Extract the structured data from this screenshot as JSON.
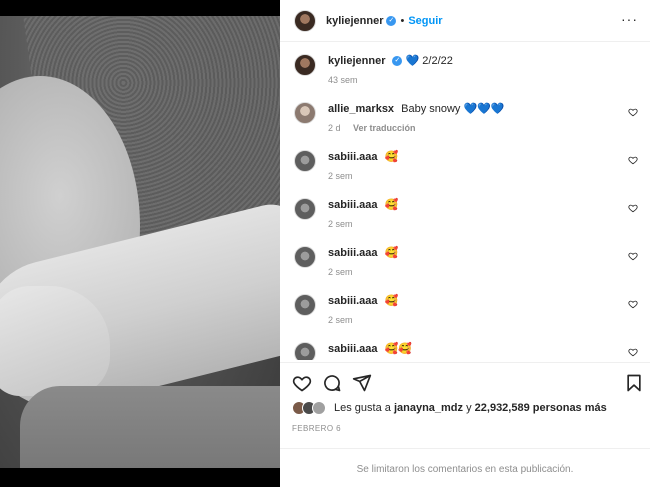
{
  "post": {
    "username": "kyliejenner",
    "follow_label": "Seguir",
    "more_label": "···"
  },
  "caption": {
    "username": "kyliejenner",
    "text": "💙 2/2/22",
    "age": "43 sem"
  },
  "comments": [
    {
      "username": "allie_marksx",
      "text": "Baby snowy 💙💙💙",
      "age": "2 d",
      "translate": "Ver traducción"
    },
    {
      "username": "sabiii.aaa",
      "text": "🥰",
      "age": "2 sem"
    },
    {
      "username": "sabiii.aaa",
      "text": "🥰",
      "age": "2 sem"
    },
    {
      "username": "sabiii.aaa",
      "text": "🥰",
      "age": "2 sem"
    },
    {
      "username": "sabiii.aaa",
      "text": "🥰",
      "age": "2 sem"
    },
    {
      "username": "sabiii.aaa",
      "text": "🥰🥰",
      "age": ""
    }
  ],
  "likes": {
    "prefix": "Les gusta a",
    "user": "janayna_mdz",
    "conj": "y",
    "count": "22,932,589 personas más"
  },
  "date": "FEBRERO 6",
  "footer": "Se limitaron los comentarios en esta publicación.",
  "icons": {
    "verified": "verified-badge-icon",
    "like": "heart-icon",
    "comment": "comment-icon",
    "share": "share-icon",
    "save": "bookmark-icon"
  },
  "colors": {
    "accent": "#0095f6",
    "verified": "#3897f0",
    "muted": "#8e8e8e"
  }
}
